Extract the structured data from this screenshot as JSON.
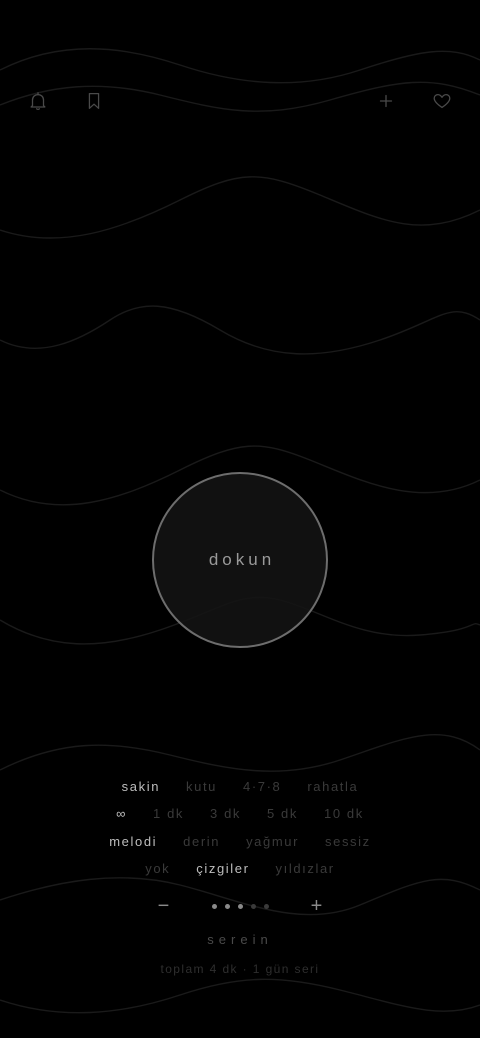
{
  "icons": {
    "left": [
      "bell-icon",
      "bookmark-icon"
    ],
    "right": [
      "plus-icon",
      "heart-icon"
    ]
  },
  "main": {
    "tap_label": "dokun"
  },
  "breath_patterns": {
    "items": [
      "sakin",
      "kutu",
      "4·7·8",
      "rahatla"
    ],
    "selected": "sakin"
  },
  "durations": {
    "items": [
      "∞",
      "1 dk",
      "3 dk",
      "5 dk",
      "10 dk"
    ],
    "selected": "∞"
  },
  "sounds": {
    "items": [
      "melodi",
      "derin",
      "yağmur",
      "sessiz"
    ],
    "selected": "melodi"
  },
  "visuals": {
    "items": [
      "yok",
      "çizgiler",
      "yıldızlar"
    ],
    "selected": "çizgiler"
  },
  "speed": {
    "minus": "−",
    "plus": "+",
    "level": 3,
    "max": 5
  },
  "footer": {
    "brand": "serein",
    "stats": "toplam 4 dk · 1 gün seri"
  },
  "colors": {
    "background": "#000000",
    "active": "#bdbdbd",
    "inactive": "#3a3a3a",
    "circle_border": "#6d6d6d"
  }
}
